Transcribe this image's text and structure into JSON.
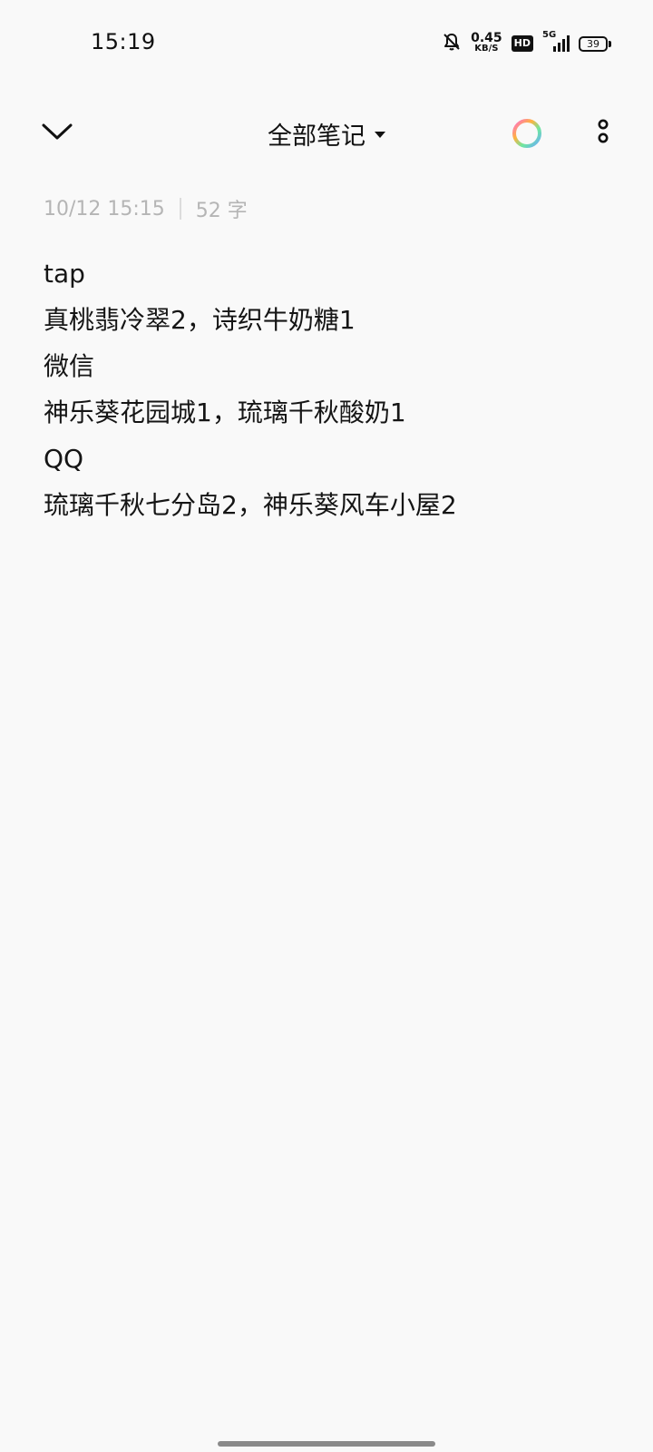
{
  "status_bar": {
    "time": "15:19",
    "net_speed_value": "0.45",
    "net_speed_unit": "KB/S",
    "hd_label": "HD",
    "network_label": "5G",
    "battery_level": "39"
  },
  "toolbar": {
    "title": "全部笔记"
  },
  "note": {
    "timestamp": "10/12 15:15",
    "word_count": "52 字",
    "lines": [
      "tap",
      "真桃翡冷翠2，诗织牛奶糖1",
      "微信",
      "神乐葵花园城1，琉璃千秋酸奶1",
      "QQ",
      "琉璃千秋七分岛2，神乐葵风车小屋2"
    ]
  },
  "icons": {
    "back": "chevron-down-icon",
    "dropdown": "caret-down-icon",
    "color": "color-ring-icon",
    "more": "more-vertical-icon",
    "mute": "bell-off-icon",
    "signal": "signal-icon"
  }
}
